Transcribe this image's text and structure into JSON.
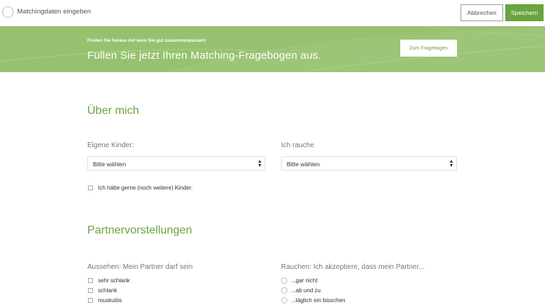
{
  "header": {
    "title": "Matchingdaten eingeben",
    "cancel_label": "Abbrechen",
    "save_label": "Speichern"
  },
  "banner": {
    "kicker": "Finden Sie heraus mit wem Sie gut zusammenpassen!",
    "headline": "Füllen Sie jetzt Ihren Matching-Fragebogen aus.",
    "button_label": "Zum Fragebogen"
  },
  "about": {
    "heading": "Über mich",
    "children_label": "Eigene Kinder:",
    "children_value": "Bitte wählen",
    "smoke_label": "Ich rauche",
    "smoke_value": "Bitte wählen",
    "wish_children_label": "Ich hätte gerne (noch weitere) Kinder."
  },
  "partner": {
    "heading": "Partnervorstellungen",
    "looks_label": "Aussehen: Mein Partner darf sein",
    "looks_options": [
      "sehr schlank",
      "schlank",
      "muskulös"
    ],
    "smoking_label": "Rauchen: Ich akzeptiere, dass mein Partner...",
    "smoking_options": [
      "...gar nicht",
      "...ab und zu",
      "...täglich ein bisschen"
    ]
  },
  "colors": {
    "accent": "#6aa33f",
    "banner": "#96c26f"
  }
}
